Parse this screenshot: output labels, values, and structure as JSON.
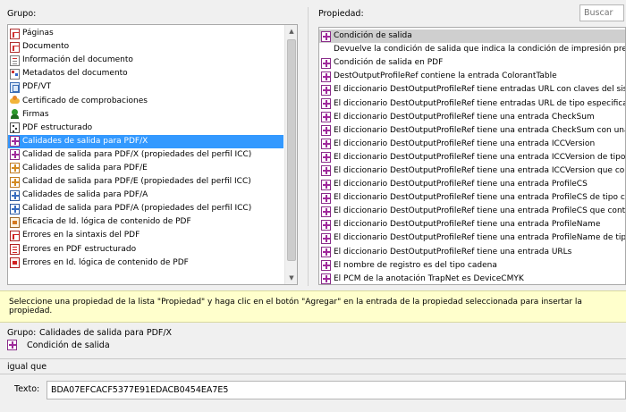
{
  "group_panel": {
    "label": "Grupo:",
    "items": [
      {
        "label": "Páginas",
        "icon": "pdf-page-icon",
        "selected": false
      },
      {
        "label": "Documento",
        "icon": "pdf-document-icon",
        "selected": false
      },
      {
        "label": "Información del documento",
        "icon": "document-info-icon",
        "selected": false
      },
      {
        "label": "Metadatos del documento",
        "icon": "metadata-icon",
        "selected": false
      },
      {
        "label": "PDF/VT",
        "icon": "pdfvt-icon",
        "selected": false
      },
      {
        "label": "Certificado de comprobaciones",
        "icon": "certificate-icon",
        "selected": false
      },
      {
        "label": "Firmas",
        "icon": "signature-icon",
        "selected": false
      },
      {
        "label": "PDF estructurado",
        "icon": "structure-icon",
        "selected": false
      },
      {
        "label": "Calidades de salida para PDF/X",
        "icon": "output-intent-pdfx-icon",
        "selected": true
      },
      {
        "label": "Calidad de salida para PDF/X (propiedades del perfil ICC)",
        "icon": "output-intent-pdfx-icon",
        "selected": false
      },
      {
        "label": "Calidades de salida para PDF/E",
        "icon": "output-intent-pdfe-icon",
        "selected": false
      },
      {
        "label": "Calidad de salida para PDF/E (propiedades del perfil ICC)",
        "icon": "output-intent-pdfe-icon",
        "selected": false
      },
      {
        "label": "Calidades de salida para PDF/A",
        "icon": "output-intent-pdfa-icon",
        "selected": false
      },
      {
        "label": "Calidad de salida para PDF/A (propiedades del perfil ICC)",
        "icon": "output-intent-pdfa-icon",
        "selected": false
      },
      {
        "label": "Eficacia de Id. lógica de contenido de PDF",
        "icon": "logic-id-icon",
        "selected": false
      },
      {
        "label": "Errores en la sintaxis del PDF",
        "icon": "syntax-error-icon",
        "selected": false
      },
      {
        "label": "Errores en PDF estructurado",
        "icon": "structure-error-icon",
        "selected": false
      },
      {
        "label": "Errores en Id. lógica de contenido de PDF",
        "icon": "logic-error-icon",
        "selected": false
      }
    ]
  },
  "property_panel": {
    "label": "Propiedad:",
    "search_placeholder": "Buscar",
    "selected_description": "Devuelve la condición de salida que indica la condición de impresión pretendida.",
    "items": [
      "Condición de salida",
      "Condición de salida en PDF",
      "DestOutputProfileRef contiene la entrada ColorantTable",
      "El diccionario DestOutputProfileRef tiene entradas URL con claves del sistema de",
      "El diccionario DestOutputProfileRef tiene entradas URL de tipo especificación de",
      "El diccionario DestOutputProfileRef tiene una entrada CheckSum",
      "El diccionario DestOutputProfileRef tiene una entrada CheckSum con una cadena",
      "El diccionario DestOutputProfileRef tiene una entrada ICCVersion",
      "El diccionario DestOutputProfileRef tiene una entrada ICCVersion de tipo cadena",
      "El diccionario DestOutputProfileRef tiene una entrada ICCVersion que contiene u",
      "El diccionario DestOutputProfileRef tiene una entrada ProfileCS",
      "El diccionario DestOutputProfileRef tiene una entrada ProfileCS de tipo cadena",
      "El diccionario DestOutputProfileRef tiene una entrada ProfileCS que contiene \"GR",
      "El diccionario DestOutputProfileRef tiene una entrada ProfileName",
      "El diccionario DestOutputProfileRef tiene una entrada ProfileName de tipo cadena",
      "El diccionario DestOutputProfileRef tiene una entrada URLs",
      "El nombre de registro es del tipo cadena",
      "El PCM de la anotación TrapNet es DeviceCMYK"
    ]
  },
  "hint": {
    "text": "Seleccione una propiedad de la lista \"Propiedad\" y haga clic en el botón \"Agregar\" en la entrada de la propiedad seleccionada para insertar la propiedad."
  },
  "selection": {
    "group_label": "Grupo:",
    "group_value": "Calidades de salida para PDF/X",
    "property_value": "Condición de salida"
  },
  "operator": {
    "value": "igual que"
  },
  "text_field": {
    "label": "Texto:",
    "value": "BDA07EFCACF5377E91EDACB0454EA7E5"
  },
  "colors": {
    "selection": "#3399ff",
    "hint_background": "#ffffcc",
    "property_selected": "#cfcfcf"
  }
}
